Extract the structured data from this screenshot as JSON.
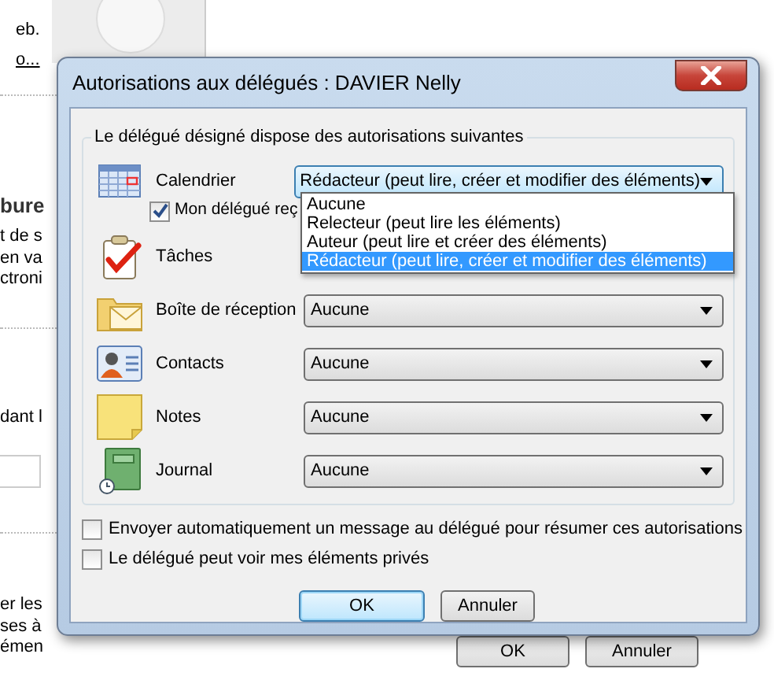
{
  "background": {
    "texts": [
      {
        "text": "eb.",
        "kind": "text"
      },
      {
        "text": "o...",
        "kind": "link"
      },
      {
        "text": "bure",
        "kind": "heading"
      },
      {
        "text": "t de s",
        "kind": "text"
      },
      {
        "text": "en va",
        "kind": "text"
      },
      {
        "text": "ctroni",
        "kind": "text"
      },
      {
        "text": "dant l",
        "kind": "text"
      },
      {
        "text": "er les",
        "kind": "text"
      },
      {
        "text": "ses à",
        "kind": "text"
      },
      {
        "text": "émen",
        "kind": "text"
      }
    ],
    "buttons": [
      "OK",
      "Annuler"
    ]
  },
  "dialog": {
    "title": "Autorisations aux délégués : DAVIER Nelly",
    "group_label": "Le délégué désigné dispose des autorisations suivantes",
    "folders": [
      {
        "kind": "calendar",
        "label": "Calendrier",
        "value": "Rédacteur (peut lire, créer et modifier des éléments)",
        "focused": true
      },
      {
        "kind": "tasks",
        "label": "Tâches"
      },
      {
        "kind": "inbox",
        "label": "Boîte de réception",
        "value": "Aucune",
        "focused": false
      },
      {
        "kind": "contacts",
        "label": "Contacts",
        "value": "Aucune",
        "focused": false
      },
      {
        "kind": "notes",
        "label": "Notes",
        "value": "Aucune",
        "focused": false
      },
      {
        "kind": "journal",
        "label": "Journal",
        "value": "Aucune",
        "focused": false
      }
    ],
    "calendar_option": {
      "label": "Mon délégué reç",
      "checked": true
    },
    "dropdown": {
      "options": [
        {
          "label": "Aucune",
          "selected": false
        },
        {
          "label": "Relecteur (peut lire les éléments)",
          "selected": false
        },
        {
          "label": "Auteur (peut lire et créer des éléments)",
          "selected": false
        },
        {
          "label": "Rédacteur (peut lire, créer et modifier des éléments)",
          "selected": true
        }
      ]
    },
    "options": [
      {
        "label": "Envoyer automatiquement un message au délégué pour résumer ces autorisations",
        "checked": false
      },
      {
        "label": "Le délégué peut voir mes éléments privés",
        "checked": false
      }
    ],
    "buttons": [
      {
        "label": "OK",
        "default": true
      },
      {
        "label": "Annuler",
        "default": false
      }
    ]
  }
}
